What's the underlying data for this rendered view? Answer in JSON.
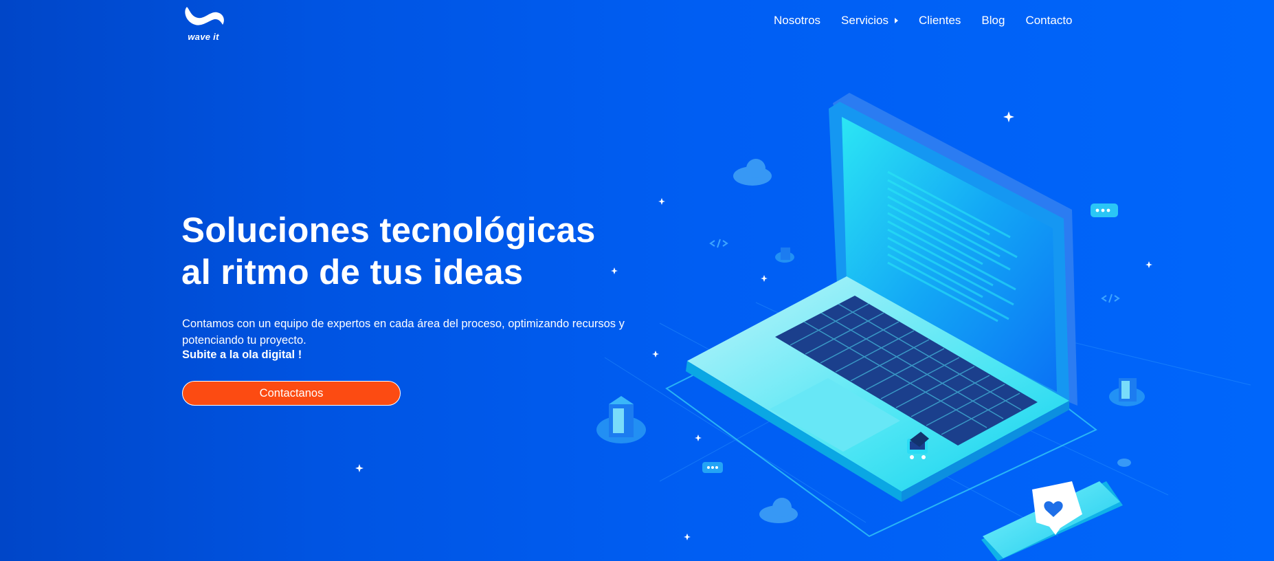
{
  "brand": {
    "logo_text": "wave it"
  },
  "nav": {
    "items": [
      {
        "label": "Nosotros"
      },
      {
        "label": "Servicios"
      },
      {
        "label": "Clientes"
      },
      {
        "label": "Blog"
      },
      {
        "label": "Contacto"
      }
    ]
  },
  "hero": {
    "title_line1": "Soluciones tecnológicas",
    "title_line2": "al ritmo de tus ideas",
    "description": "Contamos con un equipo de expertos en cada área del proceso, optimizando recursos y potenciando tu proyecto.",
    "tagline": "Subite a la ola digital !",
    "cta_label": "Contactanos"
  },
  "colors": {
    "background": "#005ef3",
    "cta": "#fc4b12",
    "accent": "#27f0f2"
  },
  "icons": [
    "wave-logo-icon",
    "caret-right-icon",
    "laptop-illustration",
    "phone-icon",
    "heart-icon",
    "cloud-icon",
    "server-icon",
    "chat-bubble-icon",
    "code-icon",
    "sparkle-icon",
    "shopping-cart-icon"
  ]
}
